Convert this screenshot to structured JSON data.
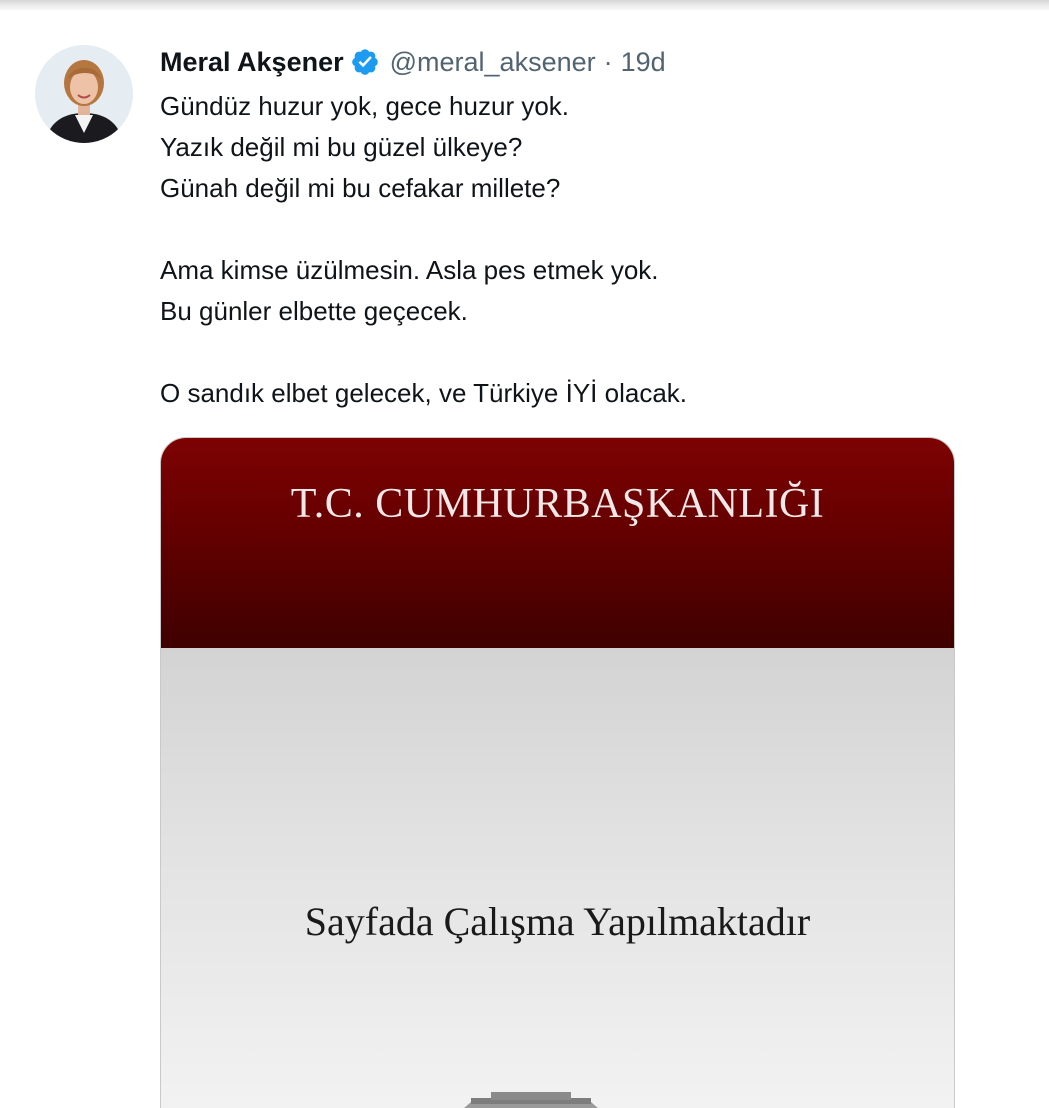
{
  "tweet": {
    "display_name": "Meral Akşener",
    "handle": "@meral_aksener",
    "separator": "·",
    "time": "19d",
    "verified": true,
    "avatar_icon": "profile-photo",
    "verified_icon": "verified-badge-icon",
    "text_lines": [
      "Gündüz huzur yok, gece huzur yok.",
      "Yazık değil mi bu güzel ülkeye?",
      "Günah değil mi bu cefakar millete?",
      "",
      "Ama kimse üzülmesin. Asla pes etmek yok.",
      "Bu günler elbette geçecek.",
      "",
      "O sandık elbet gelecek, ve Türkiye İYİ olacak."
    ]
  },
  "media": {
    "title": "T.C. CUMHURBAŞKANLIĞI",
    "message": "Sayfada Çalışma Yapılmaktadır",
    "header_color": "#6b0000",
    "body_color": "#e0e0e0"
  },
  "colors": {
    "text_primary": "#0f1419",
    "text_secondary": "#536471",
    "verified_blue": "#1d9bf0"
  }
}
